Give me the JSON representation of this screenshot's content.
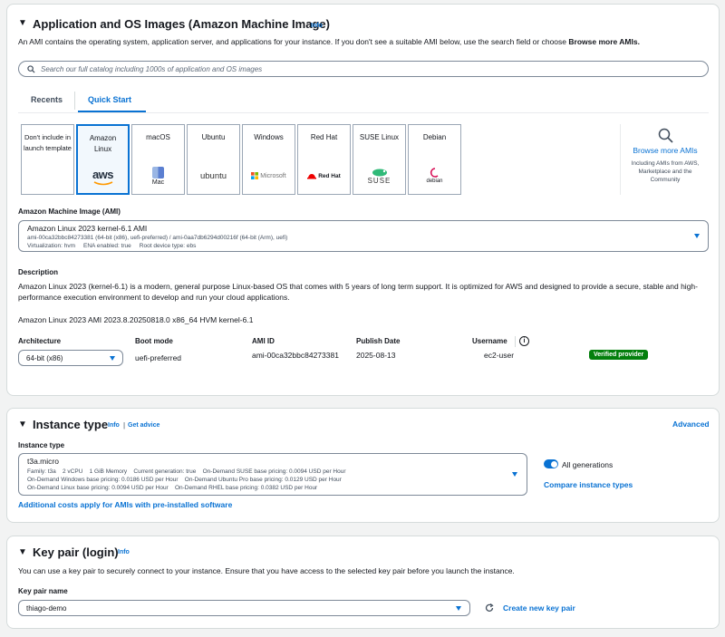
{
  "ami": {
    "title": "Application and OS Images (Amazon Machine Image)",
    "info": "Info",
    "description_prefix": "An AMI contains the operating system, application server, and applications for your instance. If you don't see a suitable AMI below, use the search field or choose ",
    "description_bold": "Browse more AMIs.",
    "search_placeholder": "Search our full catalog including 1000s of application and OS images",
    "tabs": [
      "Recents",
      "Quick Start"
    ],
    "active_tab": "Quick Start",
    "tiles": [
      {
        "name": "Don't include in launch template",
        "logo_text": ""
      },
      {
        "name": "Amazon Linux",
        "logo_text": "aws"
      },
      {
        "name": "macOS",
        "logo_text": "Mac"
      },
      {
        "name": "Ubuntu",
        "logo_text": "ubuntu"
      },
      {
        "name": "Windows",
        "logo_text": "Microsoft"
      },
      {
        "name": "Red Hat",
        "logo_text": "Red Hat"
      },
      {
        "name": "SUSE Linux",
        "logo_text": "SUSE"
      },
      {
        "name": "Debian",
        "logo_text": "debian"
      }
    ],
    "browse_more": "Browse more AMIs",
    "browse_sub": "Including AMIs from AWS, Marketplace and the Community",
    "ami_label": "Amazon Machine Image (AMI)",
    "ami_selected": "Amazon Linux 2023 kernel-6.1 AMI",
    "ami_ids": "ami-00ca32bbc84273381 (64-bit (x86), uefi-preferred) / ami-0aa7db6294d00216f (64-bit (Arm), uefi)",
    "ami_meta": "Virtualization: hvm     ENA enabled: true     Root device type: ebs",
    "desc_label": "Description",
    "desc_text": "Amazon Linux 2023 (kernel-6.1) is a modern, general purpose Linux-based OS that comes with 5 years of long term support. It is optimized for AWS and designed to provide a secure, stable and high-performance execution environment to develop and run your cloud applications.",
    "version": "Amazon Linux 2023 AMI 2023.8.20250818.0 x86_64 HVM kernel-6.1",
    "arch_label": "Architecture",
    "arch_value": "64-bit (x86)",
    "boot_label": "Boot mode",
    "boot_value": "uefi-preferred",
    "amiid_label": "AMI ID",
    "amiid_value": "ami-00ca32bbc84273381",
    "pub_label": "Publish Date",
    "pub_value": "2025-08-13",
    "user_label": "Username",
    "user_value": "ec2-user",
    "verified": "Verified provider"
  },
  "instance": {
    "title": "Instance type",
    "info": "Info",
    "separator": "|",
    "get_advice": "Get advice",
    "advanced": "Advanced",
    "field_label": "Instance type",
    "selected": "t3a.micro",
    "line1": "Family: t3a    2 vCPU    1 GiB Memory    Current generation: true    On-Demand SUSE base pricing: 0.0094 USD per Hour",
    "line2": "On-Demand Windows base pricing: 0.0186 USD per Hour    On-Demand Ubuntu Pro base pricing: 0.0129 USD per Hour",
    "line3": "On-Demand Linux base pricing: 0.0094 USD per Hour    On-Demand RHEL base pricing: 0.0382 USD per Hour",
    "all_generations": "All generations",
    "compare": "Compare instance types",
    "additional": "Additional costs apply for AMIs with pre-installed software"
  },
  "keypair": {
    "title": "Key pair (login)",
    "info": "Info",
    "description": "You can use a key pair to securely connect to your instance. Ensure that you have access to the selected key pair before you launch the instance.",
    "label": "Key pair name",
    "value": "thiago-demo",
    "create": "Create new key pair"
  },
  "colors": {
    "link": "#0972d3",
    "verified": "#037f0c",
    "border": "#d5dbdb"
  }
}
